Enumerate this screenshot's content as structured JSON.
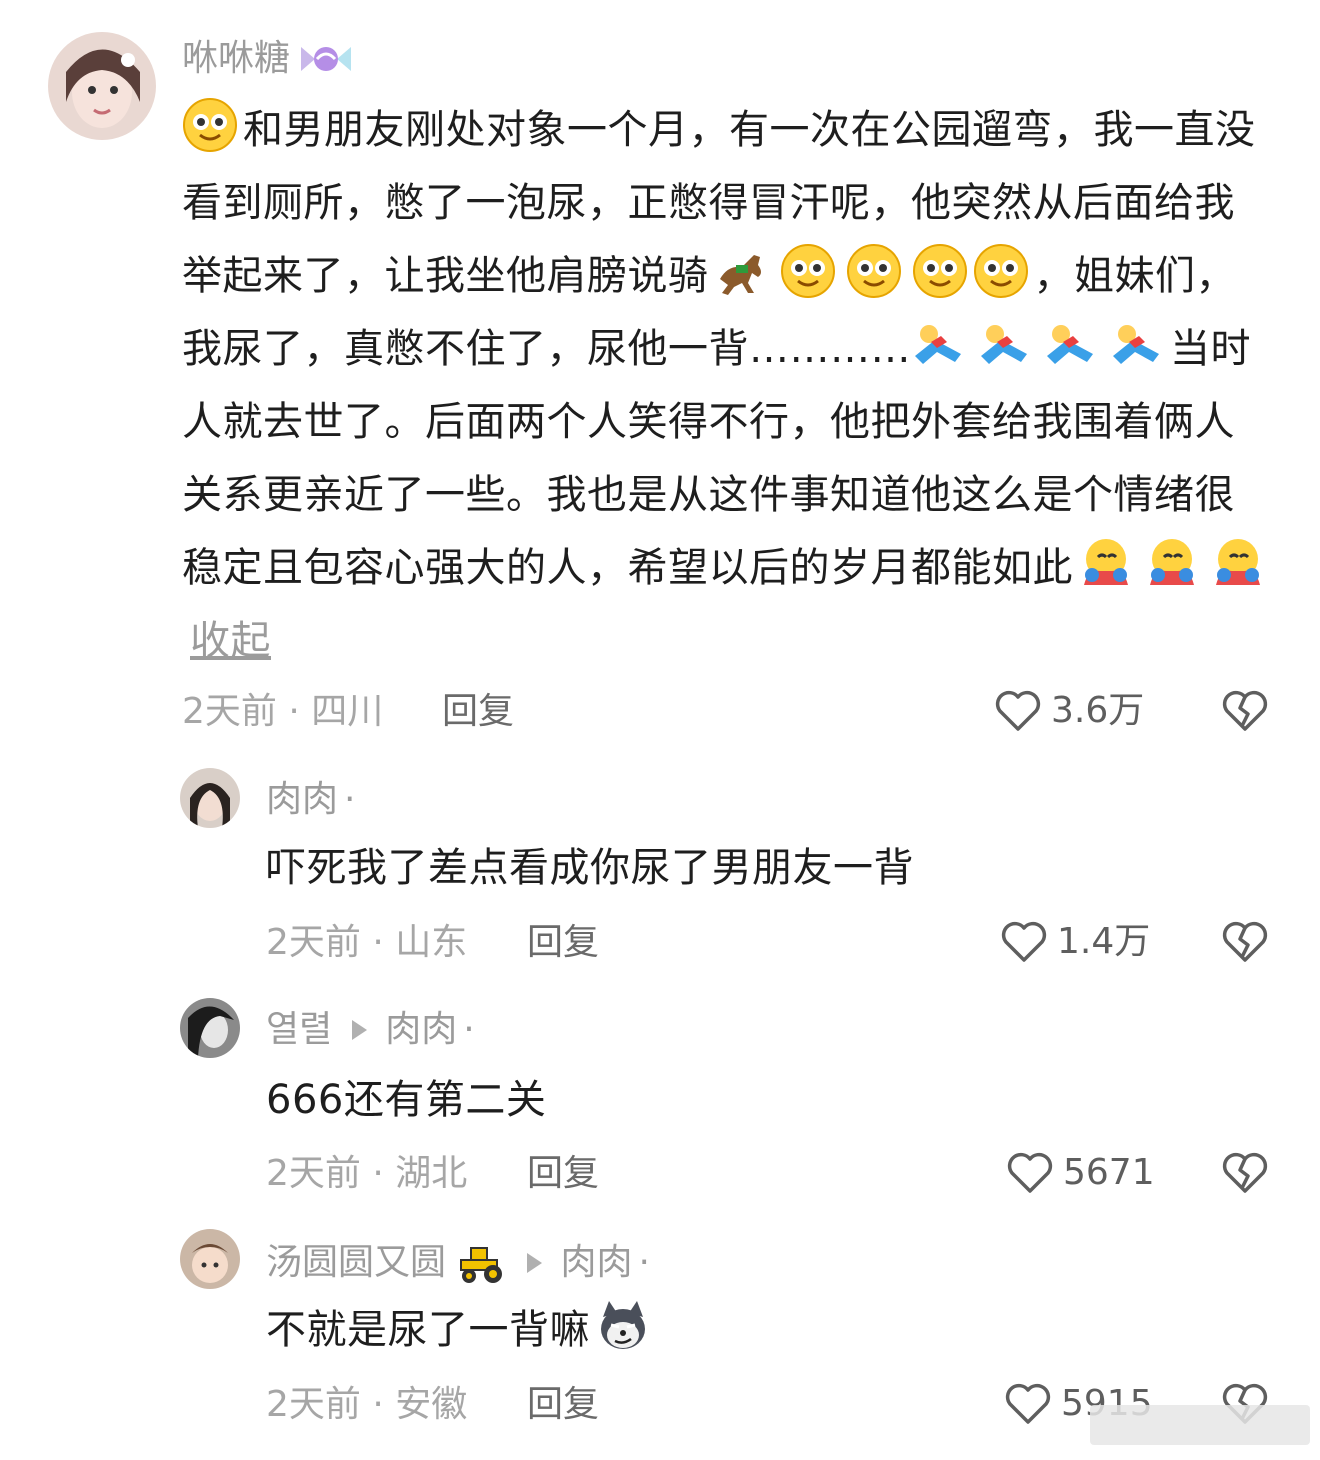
{
  "main_comment": {
    "username": "咻咻糖",
    "text_seg1": "和男朋友刚处对象一个月，有一次在公园遛弯，我一直没看到厕所，憋了一泡尿，正憋得冒汗呢，他突然从后面给我举起来了，让我坐他肩膀说骑",
    "text_seg2": "，姐妹们，我尿了，真憋不住了，尿他一背…………",
    "text_seg3": "当时人就去世了。后面两个人笑得不行，他把外套给我围着俩人关系更亲近了一些。我也是从这件事知道他这么是个情绪很稳定且包容心强大的人，希望以后的岁月都能如此",
    "collapse_label": "收起",
    "time_location": "2天前 · 四川",
    "reply_label": "回复",
    "likes": "3.6万"
  },
  "replies": [
    {
      "username": "肉肉",
      "text": "吓死我了差点看成你尿了男朋友一背",
      "time_location": "2天前 · 山东",
      "reply_label": "回复",
      "likes": "1.4万"
    },
    {
      "username": "열렬",
      "reply_to": "肉肉",
      "text": "666还有第二关",
      "time_location": "2天前 · 湖北",
      "reply_label": "回复",
      "likes": "5671"
    },
    {
      "username": "汤圆圆又圆",
      "reply_to": "肉肉",
      "text": "不就是尿了一背嘛",
      "time_location": "2天前 · 安徽",
      "reply_label": "回复",
      "likes": "5915"
    }
  ],
  "icons": {
    "like": "heart-outline-icon",
    "dislike": "broken-heart-icon",
    "reply_arrow": "triangle-right-icon"
  }
}
